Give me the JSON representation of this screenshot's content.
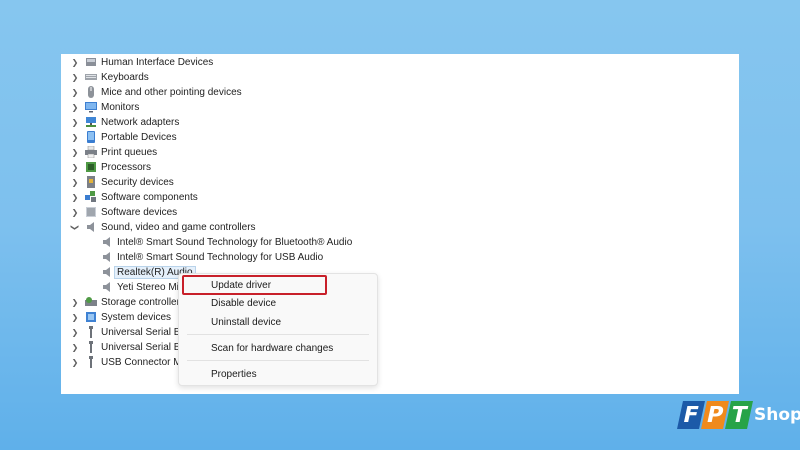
{
  "tree": {
    "categories_top": [
      {
        "label": "Human Interface Devices",
        "icon": "hid-icon"
      },
      {
        "label": "Keyboards",
        "icon": "keyboard-icon"
      },
      {
        "label": "Mice and other pointing devices",
        "icon": "mouse-icon"
      },
      {
        "label": "Monitors",
        "icon": "monitor-icon"
      },
      {
        "label": "Network adapters",
        "icon": "network-adapter-icon"
      },
      {
        "label": "Portable Devices",
        "icon": "portable-device-icon"
      },
      {
        "label": "Print queues",
        "icon": "printer-icon"
      },
      {
        "label": "Processors",
        "icon": "processor-icon"
      },
      {
        "label": "Security devices",
        "icon": "security-device-icon"
      },
      {
        "label": "Software components",
        "icon": "software-component-icon"
      },
      {
        "label": "Software devices",
        "icon": "software-device-icon"
      }
    ],
    "expanded_category": {
      "label": "Sound, video and game controllers",
      "icon": "speaker-icon"
    },
    "sound_children": [
      {
        "label": "Intel® Smart Sound Technology for Bluetooth® Audio"
      },
      {
        "label": "Intel® Smart Sound Technology for USB Audio"
      },
      {
        "label": "Realtek(R) Audio"
      },
      {
        "label": "Yeti Stereo Microphone"
      }
    ],
    "categories_bottom": [
      {
        "label": "Storage controllers",
        "icon": "storage-icon"
      },
      {
        "label": "System devices",
        "icon": "system-device-icon"
      },
      {
        "label": "Universal Serial Bus controllers",
        "icon": "usb-icon"
      },
      {
        "label": "Universal Serial Bus devices",
        "icon": "usb-icon"
      },
      {
        "label": "USB Connector Managers",
        "icon": "usb-icon"
      }
    ]
  },
  "context_menu": {
    "items": [
      {
        "label": "Update driver",
        "highlighted": true
      },
      {
        "label": "Disable device"
      },
      {
        "label": "Uninstall device"
      },
      {
        "label": "Scan for hardware changes"
      },
      {
        "label": "Properties"
      }
    ]
  },
  "logo": {
    "letters": [
      "F",
      "P",
      "T"
    ],
    "shop": "Shop",
    "colors": [
      "#1c5aa8",
      "#f08a1c",
      "#27a348"
    ]
  },
  "colors": {
    "highlight_border": "#c8202a",
    "background": "#7dc0ee",
    "selection": "#e5f0fb"
  }
}
